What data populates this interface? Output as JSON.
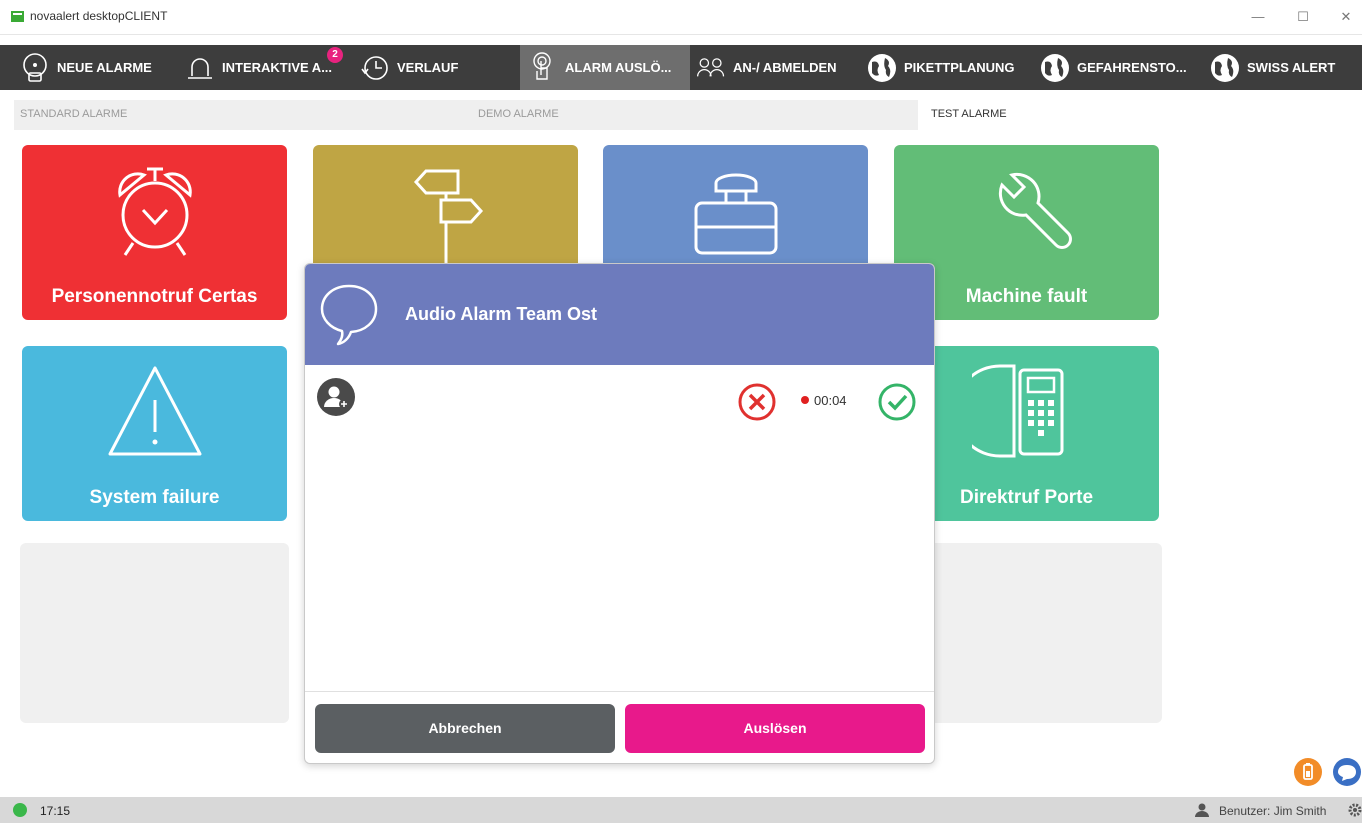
{
  "window": {
    "title": "novaalert desktopCLIENT",
    "minimize_glyph": "—",
    "maximize_glyph": "☐",
    "close_glyph": "✕"
  },
  "nav": {
    "items": [
      {
        "label": "NEUE ALARME",
        "icon": "chat-alarm-icon"
      },
      {
        "label": "INTERAKTIVE A...",
        "icon": "bell-icon",
        "badge": "2"
      },
      {
        "label": "VERLAUF",
        "icon": "history-clock-icon"
      },
      {
        "label": "ALARM AUSLÖ...",
        "icon": "touch-hand-icon",
        "active": true
      },
      {
        "label": "AN-/ ABMELDEN",
        "icon": "users-icon"
      },
      {
        "label": "PIKETTPLANUNG",
        "icon": "globe-icon"
      },
      {
        "label": "GEFAHRENSTO...",
        "icon": "globe-icon"
      },
      {
        "label": "SWISS ALERT",
        "icon": "globe-icon"
      }
    ]
  },
  "subtabs": [
    {
      "label": "STANDARD ALARME"
    },
    {
      "label": "DEMO ALARME"
    },
    {
      "label": "TEST ALARME",
      "active": true
    }
  ],
  "tiles": [
    {
      "label": "Personennotruf Certas",
      "icon": "alarm-clock-icon",
      "color": "#ef3034"
    },
    {
      "label": "",
      "icon": "signpost-icon",
      "color": "#bfa544"
    },
    {
      "label": "",
      "icon": "emergency-button-icon",
      "color": "#6a8fca"
    },
    {
      "label": "Machine fault",
      "icon": "wrench-icon",
      "color": "#62bd77"
    },
    {
      "label": "System failure",
      "icon": "warning-triangle-icon",
      "color": "#4ab9dd"
    },
    {
      "label": "Direktruf Porte",
      "icon": "phone-icon",
      "color": "#4fc59c"
    }
  ],
  "modal": {
    "title": "Audio Alarm Team Ost",
    "header_color": "#6d7bbd",
    "timer": "00:04",
    "cancel_label": "Abbrechen",
    "trigger_label": "Auslösen",
    "cancel_color": "#5b5f62",
    "trigger_color": "#e8198b"
  },
  "status": {
    "time": "17:15",
    "user": "Benutzer: Jim Smith",
    "online_color": "#3ab74a"
  }
}
